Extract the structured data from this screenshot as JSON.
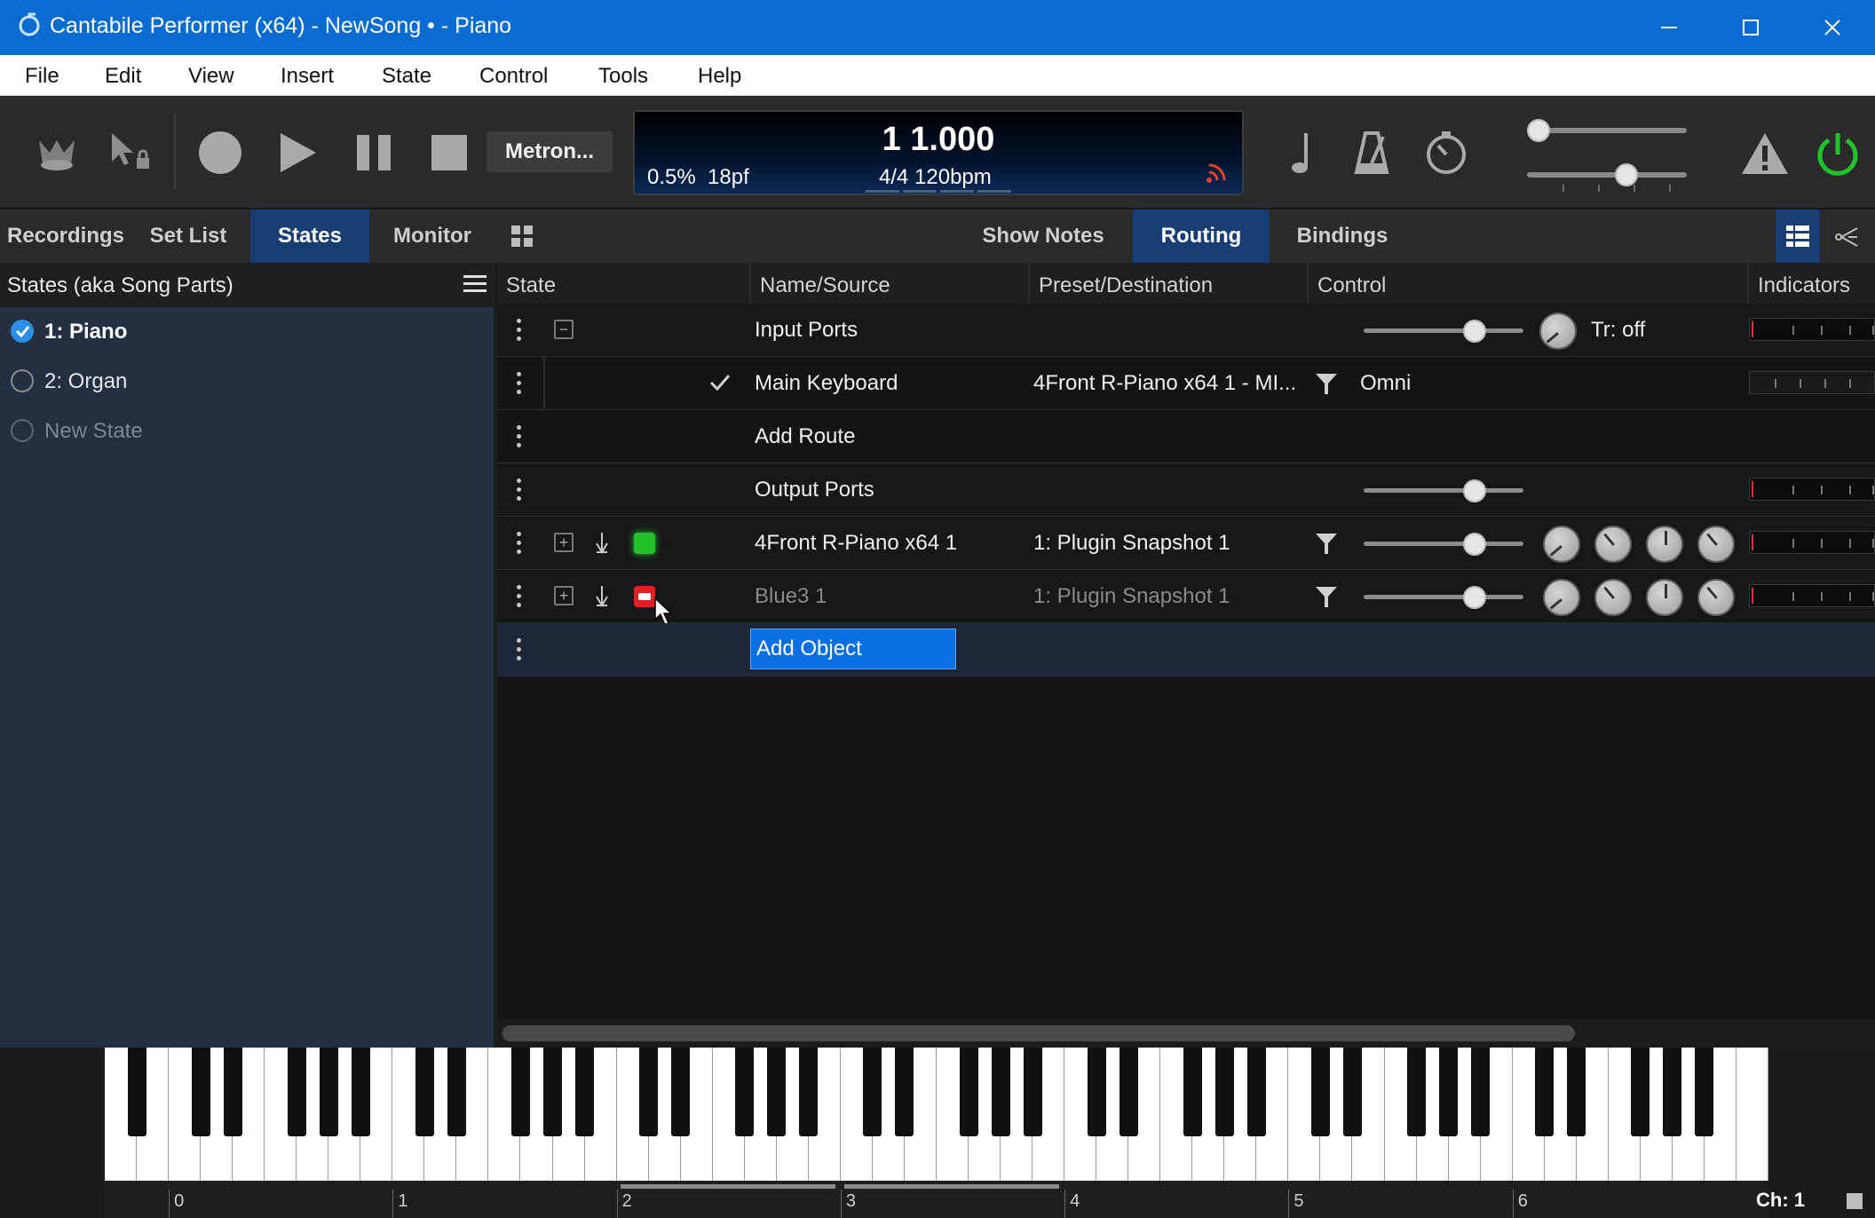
{
  "window": {
    "title": "Cantabile Performer (x64) - NewSong • - Piano",
    "title_bg": "#0a6cd1"
  },
  "menu": [
    "File",
    "Edit",
    "View",
    "Insert",
    "State",
    "Control",
    "Tools",
    "Help"
  ],
  "toolbar": {
    "metronome_label": "Metron...",
    "display": {
      "position": "1 1.000",
      "cpu": "0.5%",
      "latency": "18pf",
      "time_sig_tempo": "4/4 120bpm"
    },
    "icons": [
      "transport-icon",
      "cursor-lock-icon",
      "record-icon",
      "play-icon",
      "pause-icon",
      "stop-icon",
      "note-icon",
      "metronome-icon",
      "tap-tempo-icon",
      "warning-icon",
      "power-icon"
    ],
    "slider_top_level": 0.0,
    "slider_bottom_level": 0.64
  },
  "left_tabs": [
    {
      "label": "Recordings",
      "active": false
    },
    {
      "label": "Set List",
      "active": false
    },
    {
      "label": "States",
      "active": true
    },
    {
      "label": "Monitor",
      "active": false
    }
  ],
  "right_tabs": [
    {
      "label": "Show Notes",
      "active": false
    },
    {
      "label": "Routing",
      "active": true
    },
    {
      "label": "Bindings",
      "active": false
    }
  ],
  "states_panel": {
    "title": "States (aka Song Parts)",
    "items": [
      {
        "label": "1: Piano",
        "selected": true
      },
      {
        "label": "2: Organ",
        "selected": false
      },
      {
        "label": "New State",
        "selected": false
      }
    ]
  },
  "routing": {
    "columns": [
      "State",
      "Name/Source",
      "Preset/Destination",
      "Control",
      "Indicators"
    ],
    "rows": {
      "input_ports": {
        "name": "Input Ports",
        "transpose": "Tr: off",
        "level": 0.73
      },
      "main_keyboard": {
        "name": "Main Keyboard",
        "destination": "4Front R-Piano x64 1 - MI...",
        "channel": "Omni"
      },
      "add_route": {
        "name": "Add Route"
      },
      "output_ports": {
        "name": "Output Ports",
        "level": 0.73
      },
      "plugin1": {
        "name": "4Front R-Piano x64 1",
        "preset": "1: Plugin Snapshot 1",
        "level": 0.73,
        "status_color": "#22c22a"
      },
      "plugin2": {
        "name": "Blue3 1",
        "preset": "1: Plugin Snapshot 1",
        "level": 0.73,
        "status_color": "#e02020"
      },
      "add_object": {
        "name": "Add Object"
      }
    }
  },
  "keyboard": {
    "octave_labels": [
      "0",
      "1",
      "2",
      "3",
      "4",
      "5",
      "6"
    ],
    "channel": "Ch: 1"
  }
}
